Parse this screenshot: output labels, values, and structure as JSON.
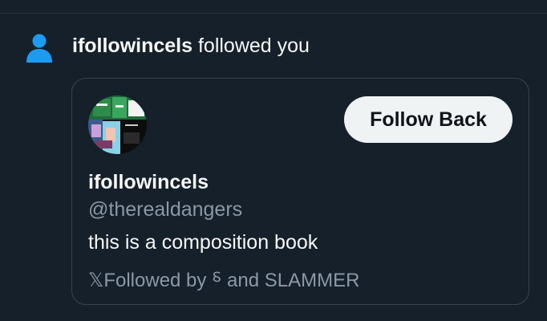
{
  "notification": {
    "icon": "person-icon",
    "username": "ifollowincels",
    "action": " followed you"
  },
  "card": {
    "avatar": "profile-avatar",
    "follow_back_label": "Follow Back",
    "display_name": "ifollowincels",
    "handle": "@therealdangers",
    "bio": "this is a composition book",
    "followed_by": "𝕏Followed by ⸹ and SLAMMER"
  },
  "colors": {
    "background": "#15202b",
    "border": "#38444d",
    "accent_icon": "#1d9bf0",
    "secondary_text": "#8b98a5",
    "button_bg": "#eff3f4"
  }
}
